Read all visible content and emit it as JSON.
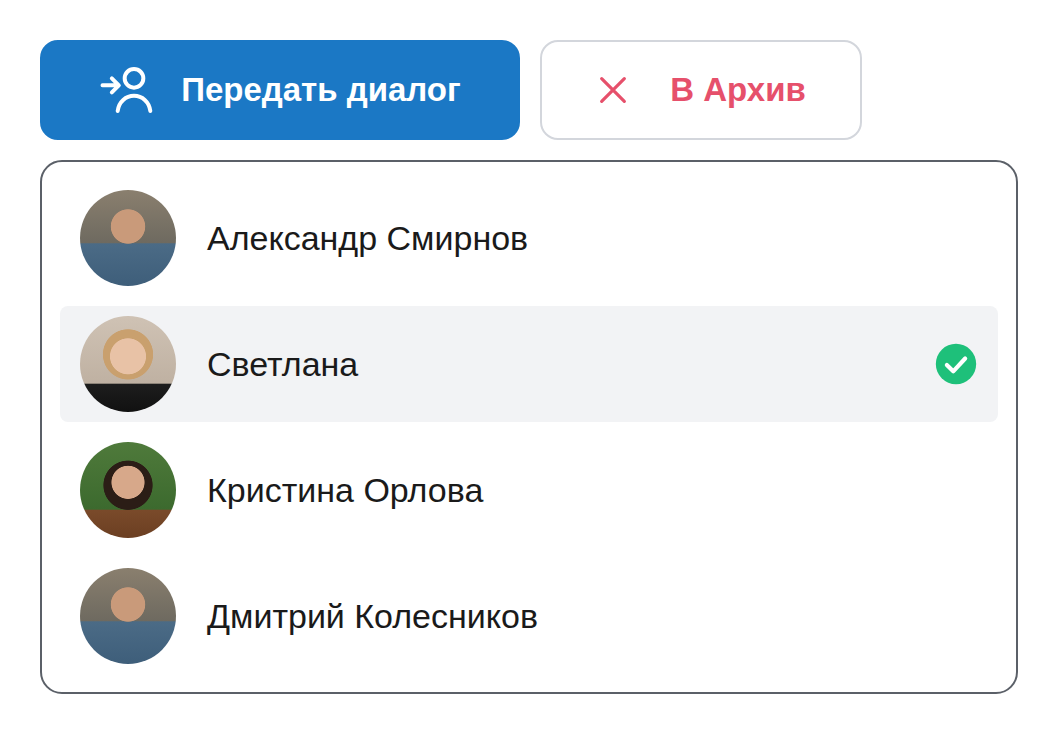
{
  "buttons": [
    {
      "label": "Передать диалог"
    },
    {
      "label": "В Архив"
    }
  ],
  "operators": [
    {
      "name": "Александр Смирнов",
      "selected": false
    },
    {
      "name": "Светлана",
      "selected": true
    },
    {
      "name": "Кристина Орлова",
      "selected": false
    },
    {
      "name": "Дмитрий Колесников",
      "selected": false
    }
  ]
}
